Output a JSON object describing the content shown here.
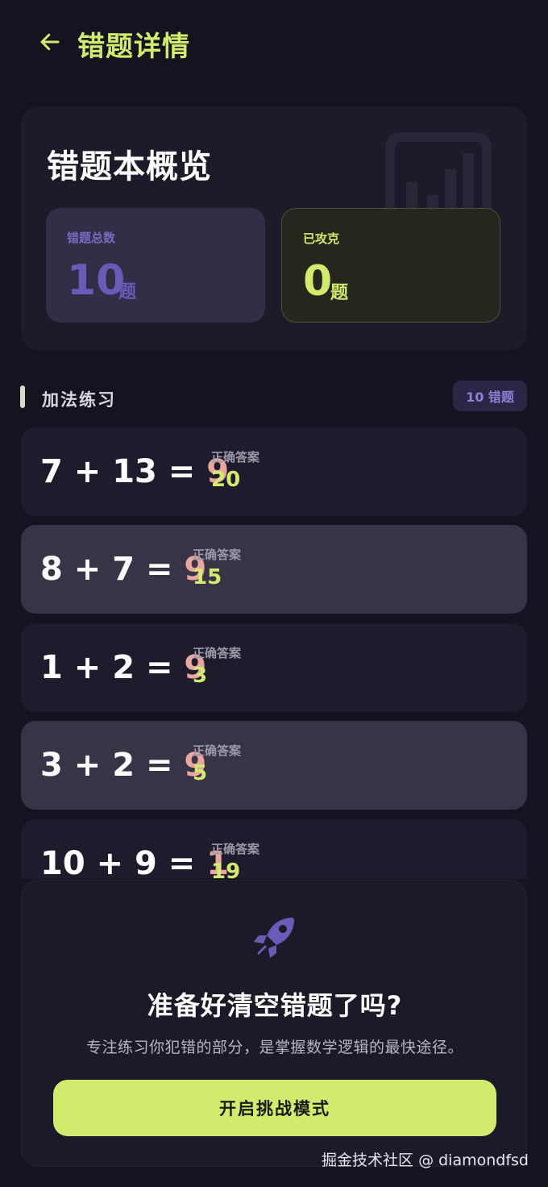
{
  "header": {
    "title": "错题详情"
  },
  "overview": {
    "title": "错题本概览",
    "total": {
      "label": "错题总数",
      "value": "10",
      "unit": "题"
    },
    "solved": {
      "label": "已攻克",
      "value": "0",
      "unit": "题"
    }
  },
  "section": {
    "title": "加法练习",
    "badge": "10 错题"
  },
  "answer_label": "正确答案",
  "items": [
    {
      "expr": "7 + 13 = ",
      "wrong": "9",
      "correct": "20"
    },
    {
      "expr": "8 + 7 = ",
      "wrong": "9",
      "correct": "15"
    },
    {
      "expr": "1 + 2 = ",
      "wrong": "9",
      "correct": "3"
    },
    {
      "expr": "3 + 2 = ",
      "wrong": "9",
      "correct": "5"
    },
    {
      "expr": "10 + 9 = ",
      "wrong": "1",
      "correct": "19"
    }
  ],
  "challenge": {
    "icon": "rocket-icon",
    "title": "准备好清空错题了吗?",
    "description": "专注练习你犯错的部分，是掌握数学逻辑的最快途径。",
    "button_label": "开启挑战模式"
  },
  "watermark": "掘金技术社区 @ diamondfsd",
  "colors": {
    "accent": "#d1ec6c",
    "purple": "#6c5ab8",
    "wrong": "#eaa7a0",
    "background": "#15131f"
  }
}
